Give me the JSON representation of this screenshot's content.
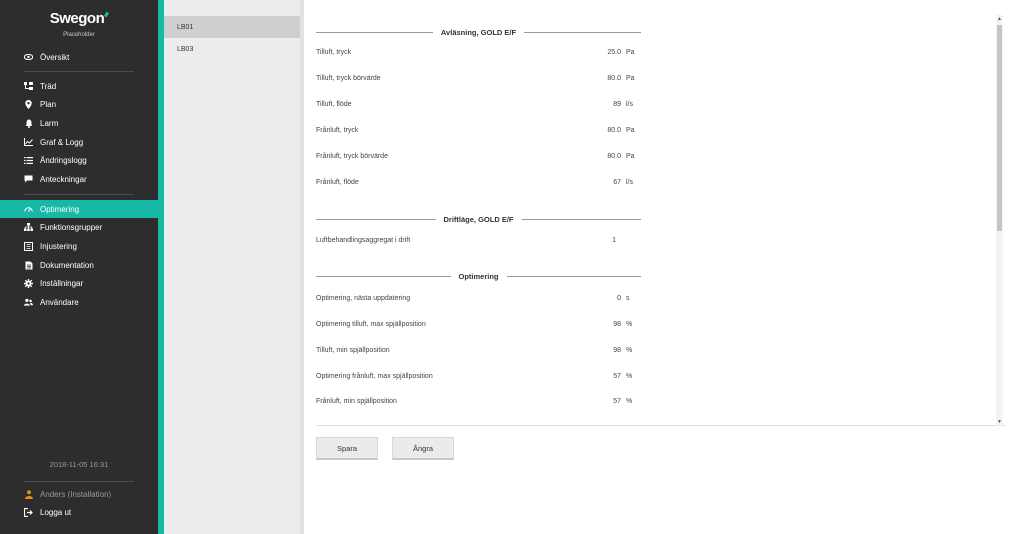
{
  "brand": {
    "logo": "Swegon",
    "subtitle": "Placeholder",
    "accent": "#17b9a6"
  },
  "sidebar": {
    "items": [
      {
        "label": "Översikt",
        "icon": "eye-icon"
      },
      {
        "label": "Träd",
        "icon": "tree-icon"
      },
      {
        "label": "Plan",
        "icon": "map-pin-icon"
      },
      {
        "label": "Larm",
        "icon": "bell-icon"
      },
      {
        "label": "Graf & Logg",
        "icon": "chart-icon"
      },
      {
        "label": "Ändringslogg",
        "icon": "list-icon"
      },
      {
        "label": "Anteckningar",
        "icon": "comment-icon"
      },
      {
        "label": "Optimering",
        "icon": "gauge-icon",
        "active": true
      },
      {
        "label": "Funktionsgrupper",
        "icon": "sitemap-icon"
      },
      {
        "label": "Injustering",
        "icon": "sliders-icon"
      },
      {
        "label": "Dokumentation",
        "icon": "document-icon"
      },
      {
        "label": "Inställningar",
        "icon": "gear-icon"
      },
      {
        "label": "Användare",
        "icon": "users-icon"
      }
    ],
    "datetime": "2018-11-05 16:31",
    "user": "Anders (Installation)",
    "logout": "Logga ut"
  },
  "subnav": {
    "items": [
      "LB01",
      "LB03"
    ],
    "selected": "LB01"
  },
  "sections": [
    {
      "title": "Avläsning, GOLD E/F",
      "rows": [
        {
          "label": "Tilluft, tryck",
          "value": "25.0",
          "unit": "Pa"
        },
        {
          "label": "Tilluft, tryck börvärde",
          "value": "80.0",
          "unit": "Pa"
        },
        {
          "label": "Tilluft, flöde",
          "value": "89",
          "unit": "l/s"
        },
        {
          "label": "Frånluft, tryck",
          "value": "80.0",
          "unit": "Pa"
        },
        {
          "label": "Frånluft, tryck börvärde",
          "value": "80.0",
          "unit": "Pa"
        },
        {
          "label": "Frånluft, flöde",
          "value": "67",
          "unit": "l/s"
        }
      ]
    },
    {
      "title": "Driftläge, GOLD E/F",
      "rows": [
        {
          "label": "Luftbehandlingsaggregat i drift",
          "value": "1",
          "unit": ""
        }
      ]
    },
    {
      "title": "Optimering",
      "rows": [
        {
          "label": "Optimering, nästa uppdatering",
          "value": "0",
          "unit": "s"
        },
        {
          "label": "Optimering tilluft, max spjällposition",
          "value": "98",
          "unit": "%"
        },
        {
          "label": "Tilluft, min spjällposition",
          "value": "98",
          "unit": "%"
        },
        {
          "label": "Optimering frånluft, max spjällposition",
          "value": "57",
          "unit": "%"
        },
        {
          "label": "Frånluft, min spjällposition",
          "value": "57",
          "unit": "%"
        }
      ]
    }
  ],
  "actions": {
    "save": "Spara",
    "undo": "Ångra"
  }
}
